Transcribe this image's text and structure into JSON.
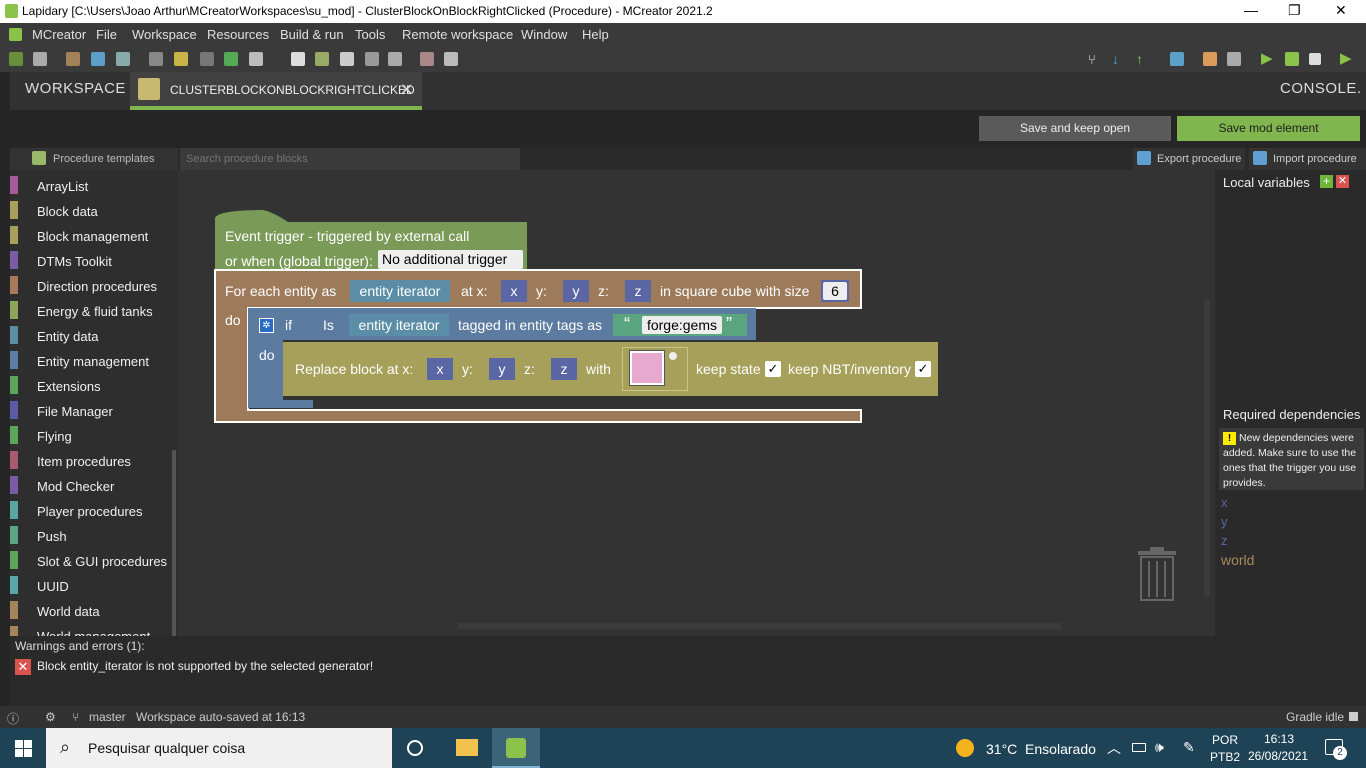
{
  "window": {
    "title": "Lapidary [C:\\Users\\Joao Arthur\\MCreatorWorkspaces\\su_mod] - ClusterBlockOnBlockRightClicked (Procedure) - MCreator 2021.2"
  },
  "menu": [
    "MCreator",
    "File",
    "Workspace",
    "Resources",
    "Build & run",
    "Tools",
    "Remote workspace",
    "Window",
    "Help"
  ],
  "tabs": {
    "workspace": "WORKSPACE",
    "procedure": "CLUSTERBLOCKONBLOCKRIGHTCLICKED",
    "console": "CONSOLE."
  },
  "buttons": {
    "save_keep": "Save and keep open",
    "save_mod": "Save mod element",
    "export": "Export procedure",
    "import": "Import procedure"
  },
  "palette": {
    "templates_label": "Procedure templates",
    "search_placeholder": "Search procedure blocks",
    "categories": [
      {
        "label": "ArrayList",
        "color": "#a55b9e"
      },
      {
        "label": "Block data",
        "color": "#a6a05a"
      },
      {
        "label": "Block management",
        "color": "#a6a05a"
      },
      {
        "label": "DTMs Toolkit",
        "color": "#7a5ba6"
      },
      {
        "label": "Direction procedures",
        "color": "#a67a5b"
      },
      {
        "label": "Energy & fluid tanks",
        "color": "#8ea65b"
      },
      {
        "label": "Entity data",
        "color": "#5b8ea6"
      },
      {
        "label": "Entity management",
        "color": "#5b80a6"
      },
      {
        "label": "Extensions",
        "color": "#5ba65b"
      },
      {
        "label": "File Manager",
        "color": "#5b5ba6"
      },
      {
        "label": "Flying",
        "color": "#5ba65b"
      },
      {
        "label": "Item procedures",
        "color": "#a65b6e"
      },
      {
        "label": "Mod Checker",
        "color": "#7a5ba6"
      },
      {
        "label": "Player procedures",
        "color": "#5ba6a1"
      },
      {
        "label": "Push",
        "color": "#5ba680"
      },
      {
        "label": "Slot & GUI procedures",
        "color": "#5ba65b"
      },
      {
        "label": "UUID",
        "color": "#5ba6a6"
      },
      {
        "label": "World data",
        "color": "#a6845b"
      },
      {
        "label": "World management",
        "color": "#a6845b"
      }
    ]
  },
  "blocks": {
    "trigger_line1": "Event trigger - triggered by external call",
    "trigger_line2": "or when (global trigger):",
    "trigger_dropdown": "No additional trigger",
    "foreach_label": "For each entity as",
    "entity_iterator": "entity iterator",
    "at_x": "at x:",
    "y_label": "y:",
    "z_label": "z:",
    "x_var": "x",
    "y_var": "y",
    "z_var": "z",
    "cube_label": "in square cube with size",
    "cube_size": "6",
    "do_label": "do",
    "if_label": "if",
    "is_label": "Is",
    "tagged_label": "tagged in entity tags as",
    "quote_open": "“",
    "quote_close": "”",
    "tag_value": "forge:gems",
    "replace_label": "Replace block at x:",
    "with_label": "with",
    "keep_state": "keep state",
    "keep_nbt": "keep NBT/inventory",
    "check": "✓"
  },
  "right_panel": {
    "local_vars": "Local variables",
    "add": "+",
    "del": "✕",
    "required_deps": "Required dependencies",
    "warn_bang": "!",
    "warn_text": "New dependencies were added. Make sure to use the ones that the trigger you use provides.",
    "deps": [
      {
        "name": "x",
        "color": "#5b67a5"
      },
      {
        "name": "y",
        "color": "#5b67a5"
      },
      {
        "name": "z",
        "color": "#5b67a5"
      },
      {
        "name": "world",
        "color": "#a68a5b"
      }
    ]
  },
  "errors": {
    "title": "Warnings and errors (1):",
    "icon": "✕",
    "message": "Block entity_iterator is not supported by the selected generator!"
  },
  "status": {
    "branch": "master",
    "autosave": "Workspace auto-saved at 16:13",
    "gradle": "Gradle idle"
  },
  "taskbar": {
    "search": "Pesquisar qualquer coisa",
    "weather": "31°C  Ensolarado",
    "lang1": "POR",
    "lang2": "PTB2",
    "time": "16:13",
    "date": "26/08/2021",
    "notif": "2"
  }
}
